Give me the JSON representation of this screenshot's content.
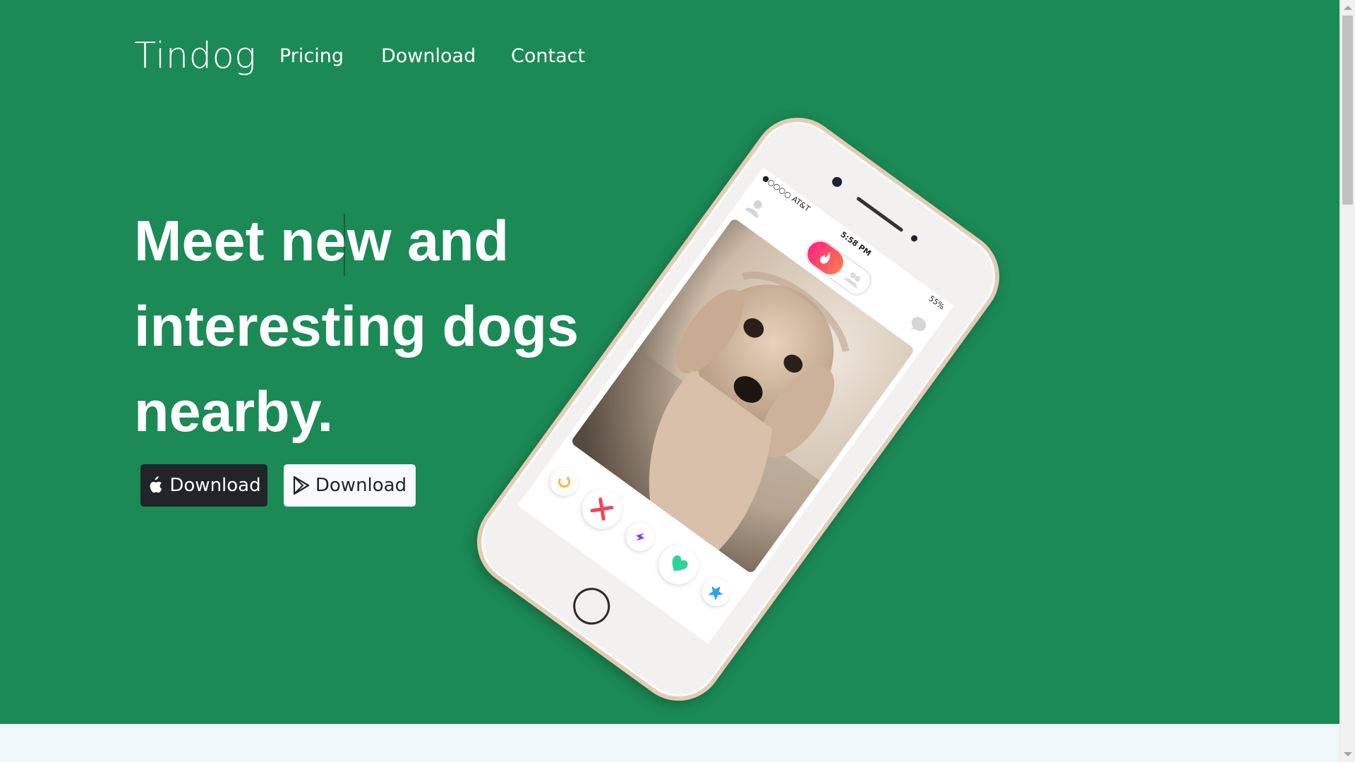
{
  "navbar": {
    "brand": "Tindog",
    "links": [
      "Pricing",
      "Download",
      "Contact"
    ]
  },
  "hero": {
    "headline_lines": [
      "Meet new and",
      "interesting dogs",
      "nearby."
    ],
    "buttons": [
      {
        "label": "Download",
        "icon": "apple-icon",
        "style": "dark"
      },
      {
        "label": "Download",
        "icon": "google-play-icon",
        "style": "light"
      }
    ]
  },
  "phone": {
    "carrier": "●○○○○ AT&T",
    "time": "5:58 PM",
    "battery": "55%"
  },
  "colors": {
    "hero_bg": "#1b8a56",
    "section_bg": "#eff7f8",
    "dark_button": "#212529",
    "light_button": "#f8f9fa"
  }
}
